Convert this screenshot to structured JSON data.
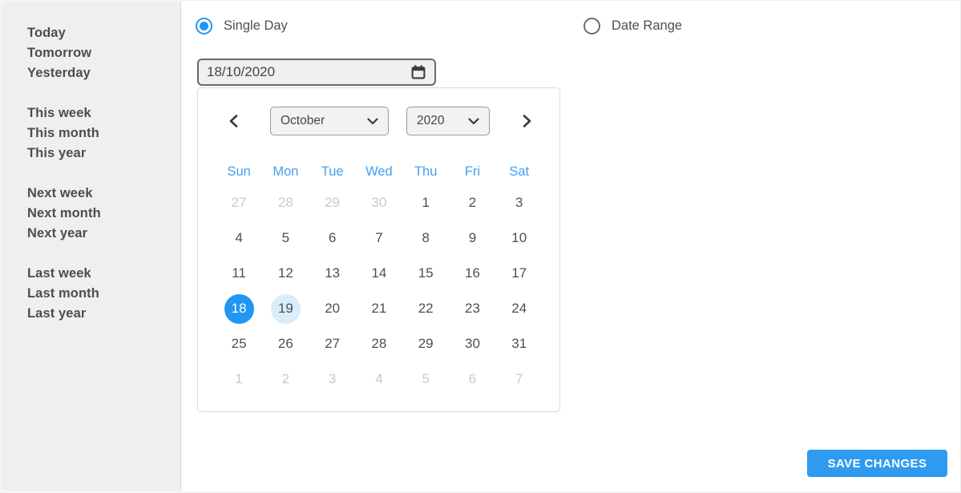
{
  "sidebar": {
    "groups": [
      {
        "items": [
          "Today",
          "Tomorrow",
          "Yesterday"
        ]
      },
      {
        "items": [
          "This week",
          "This month",
          "This year"
        ]
      },
      {
        "items": [
          "Next week",
          "Next month",
          "Next year"
        ]
      },
      {
        "items": [
          "Last week",
          "Last month",
          "Last year"
        ]
      }
    ]
  },
  "mode": {
    "single_day_label": "Single Day",
    "date_range_label": "Date Range",
    "selected": "Single Day"
  },
  "date_input": {
    "value": "18/10/2020"
  },
  "calendar": {
    "month": "October",
    "year": "2020",
    "weekdays": [
      "Sun",
      "Mon",
      "Tue",
      "Wed",
      "Thu",
      "Fri",
      "Sat"
    ],
    "weeks": [
      [
        {
          "d": "27",
          "state": "muted"
        },
        {
          "d": "28",
          "state": "muted"
        },
        {
          "d": "29",
          "state": "muted"
        },
        {
          "d": "30",
          "state": "muted"
        },
        {
          "d": "1",
          "state": "normal"
        },
        {
          "d": "2",
          "state": "normal"
        },
        {
          "d": "3",
          "state": "normal"
        }
      ],
      [
        {
          "d": "4",
          "state": "normal"
        },
        {
          "d": "5",
          "state": "normal"
        },
        {
          "d": "6",
          "state": "normal"
        },
        {
          "d": "7",
          "state": "normal"
        },
        {
          "d": "8",
          "state": "normal"
        },
        {
          "d": "9",
          "state": "normal"
        },
        {
          "d": "10",
          "state": "normal"
        }
      ],
      [
        {
          "d": "11",
          "state": "normal"
        },
        {
          "d": "12",
          "state": "normal"
        },
        {
          "d": "13",
          "state": "normal"
        },
        {
          "d": "14",
          "state": "normal"
        },
        {
          "d": "15",
          "state": "normal"
        },
        {
          "d": "16",
          "state": "normal"
        },
        {
          "d": "17",
          "state": "normal"
        }
      ],
      [
        {
          "d": "18",
          "state": "selected"
        },
        {
          "d": "19",
          "state": "highlighted"
        },
        {
          "d": "20",
          "state": "normal"
        },
        {
          "d": "21",
          "state": "normal"
        },
        {
          "d": "22",
          "state": "normal"
        },
        {
          "d": "23",
          "state": "normal"
        },
        {
          "d": "24",
          "state": "normal"
        }
      ],
      [
        {
          "d": "25",
          "state": "normal"
        },
        {
          "d": "26",
          "state": "normal"
        },
        {
          "d": "27",
          "state": "normal"
        },
        {
          "d": "28",
          "state": "normal"
        },
        {
          "d": "29",
          "state": "normal"
        },
        {
          "d": "30",
          "state": "normal"
        },
        {
          "d": "31",
          "state": "normal"
        }
      ],
      [
        {
          "d": "1",
          "state": "muted"
        },
        {
          "d": "2",
          "state": "muted"
        },
        {
          "d": "3",
          "state": "muted"
        },
        {
          "d": "4",
          "state": "muted"
        },
        {
          "d": "5",
          "state": "muted"
        },
        {
          "d": "6",
          "state": "muted"
        },
        {
          "d": "7",
          "state": "muted"
        }
      ]
    ],
    "selected_day": "18",
    "highlighted_day": "19"
  },
  "save_button": {
    "label": "SAVE CHANGES"
  },
  "colors": {
    "accent_blue": "#2196f3",
    "weekday_blue": "#41a0f0",
    "highlight_blue": "#d9edfb",
    "button_blue": "#2e9bf0",
    "sidebar_bg": "#efefef",
    "muted_day": "#c9c9c9"
  }
}
